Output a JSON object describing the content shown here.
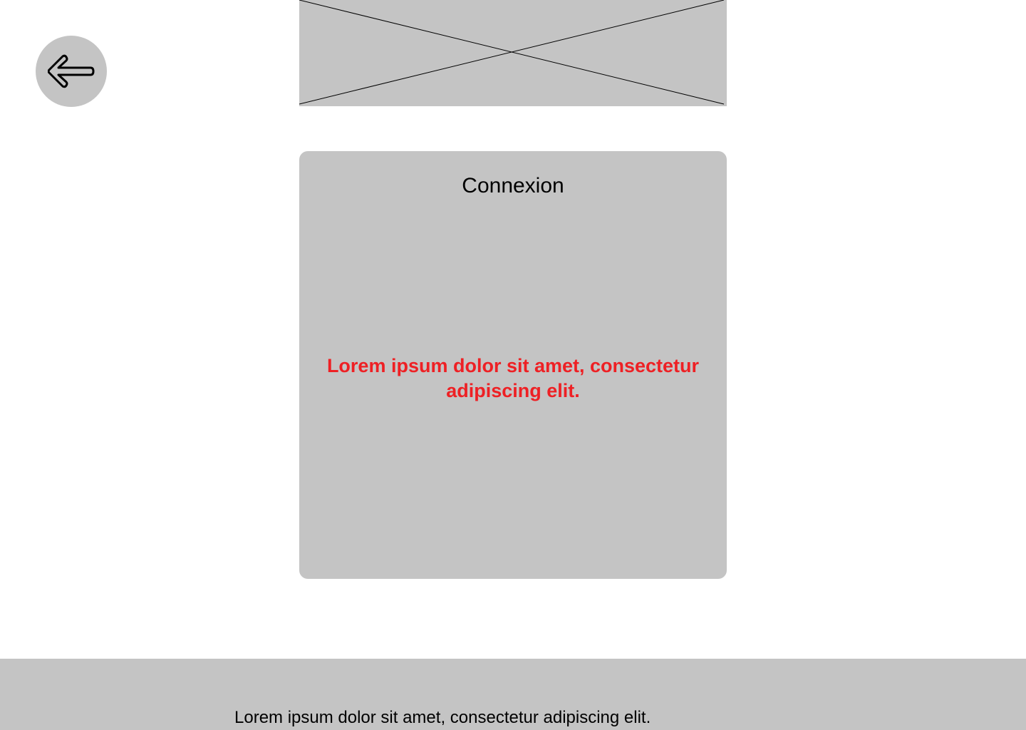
{
  "nav": {
    "back_icon": "arrow-left-icon"
  },
  "header": {
    "image_icon": "image-placeholder-icon"
  },
  "login_card": {
    "title": "Connexion",
    "message": "Lorem ipsum dolor sit amet, consectetur adipiscing elit."
  },
  "footer": {
    "text": "Lorem ipsum dolor sit amet, consectetur adipiscing elit."
  },
  "colors": {
    "placeholder_gray": "#c4c4c4",
    "error_red": "#ee2024",
    "text": "#000000",
    "background": "#ffffff"
  }
}
